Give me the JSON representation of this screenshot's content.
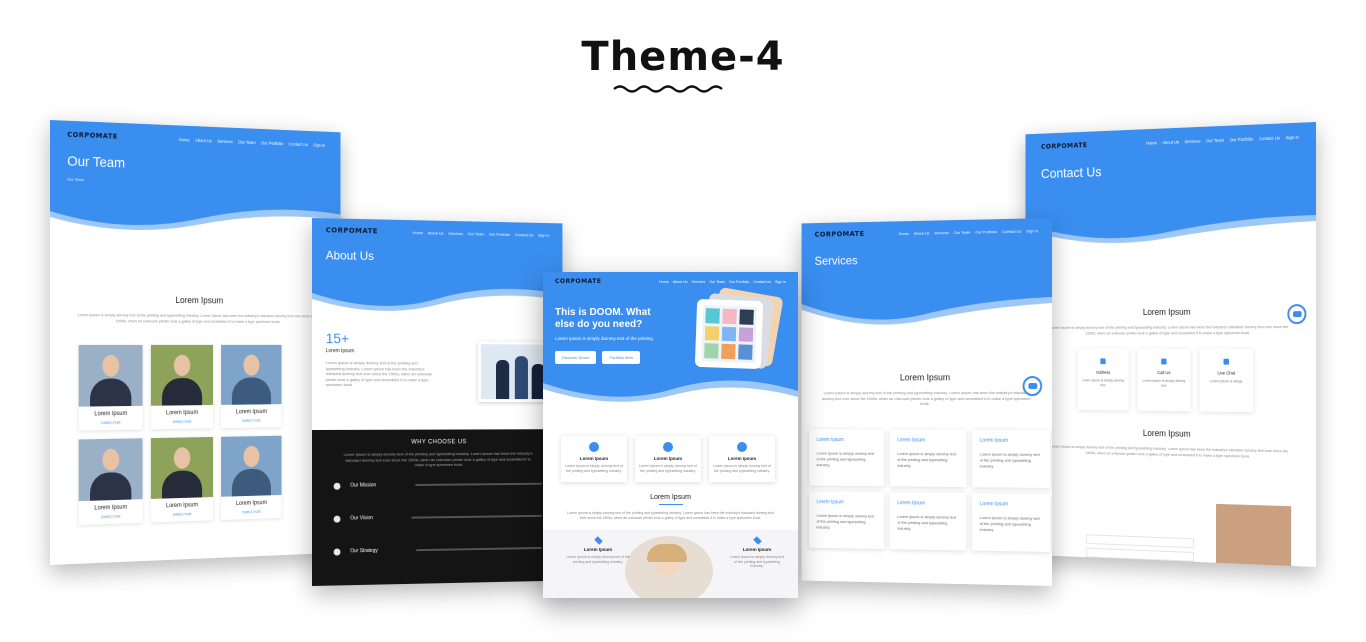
{
  "page": {
    "title": "Theme-4"
  },
  "brand": {
    "logo": "CORPOMATE",
    "accent": "#3a8ef0",
    "dark": "#141414"
  },
  "nav": [
    "Home",
    "About Us",
    "Services",
    "Our Team",
    "Our Portfolio",
    "Contact Us",
    "Sign in"
  ],
  "team": {
    "title": "Our Team",
    "breadcrumb": "Our Team",
    "section_title": "Lorem Ipsum",
    "members": [
      {
        "name": "Lorem Ipsum",
        "role": "DIRECTOR"
      },
      {
        "name": "Lorem Ipsum",
        "role": "DIRECTOR"
      },
      {
        "name": "Lorem Ipsum",
        "role": "DIRECTOR"
      },
      {
        "name": "Lorem Ipsum",
        "role": "DIRECTOR"
      },
      {
        "name": "Lorem Ipsum",
        "role": "DIRECTOR"
      },
      {
        "name": "Lorem Ipsum",
        "role": "DIRECTOR"
      }
    ]
  },
  "about": {
    "title": "About Us",
    "count": "15+",
    "count_label": "Lorem Ipsum",
    "why_title": "WHY CHOOSE US",
    "why_items": [
      "Our Mission",
      "Our Vision",
      "Our Strategy"
    ]
  },
  "home": {
    "headline": "This is DOOM. What else do you need?",
    "subtext": "Lorem Ipsum is simply dummy text of the printing.",
    "btn_primary": "Discover Doom",
    "btn_secondary": "Portfolio Item",
    "features": [
      {
        "title": "Lorem Ipsum",
        "desc": "Lorem Ipsum is simply dummy text of the printing and typesetting industry."
      },
      {
        "title": "Lorem Ipsum",
        "desc": "Lorem Ipsum is simply dummy text of the printing and typesetting industry."
      },
      {
        "title": "Lorem Ipsum",
        "desc": "Lorem Ipsum is simply dummy text of the printing and typesetting industry."
      }
    ],
    "section_title": "Lorem Ipsum",
    "bottom_left_title": "Lorem Ipsum",
    "bottom_left_desc": "Lorem Ipsum is simply dummy text of the printing and typesetting industry.",
    "bottom_right_title": "Lorem Ipsum",
    "bottom_right_desc": "Lorem Ipsum is simply dummy text of the printing and typesetting industry."
  },
  "services": {
    "title": "Services",
    "section_title": "Lorem Ipsum",
    "items": [
      {
        "title": "Lorem Ipsum",
        "desc": "Lorem Ipsum is simply dummy text of the printing and typesetting industry."
      },
      {
        "title": "Lorem Ipsum",
        "desc": "Lorem Ipsum is simply dummy text of the printing and typesetting industry."
      },
      {
        "title": "Lorem Ipsum",
        "desc": "Lorem Ipsum is simply dummy text of the printing and typesetting industry."
      },
      {
        "title": "Lorem Ipsum",
        "desc": "Lorem Ipsum is simply dummy text of the printing and typesetting industry."
      },
      {
        "title": "Lorem Ipsum",
        "desc": "Lorem Ipsum is simply dummy text of the printing and typesetting industry."
      },
      {
        "title": "Lorem Ipsum",
        "desc": "Lorem Ipsum is simply dummy text of the printing and typesetting industry."
      }
    ]
  },
  "contact": {
    "title": "Contact Us",
    "section_title": "Lorem Ipsum",
    "section_title_2": "Lorem Ipsum",
    "info": [
      {
        "title": "Address",
        "desc": "Lorem Ipsum is simply dummy text"
      },
      {
        "title": "Call Us",
        "desc": "Lorem Ipsum is simply dummy text"
      },
      {
        "title": "Live Chat",
        "desc": "Lorem Ipsum is simply"
      }
    ]
  },
  "lorem_para": "Lorem Ipsum is simply dummy text of the printing and typesetting industry. Lorem Ipsum has been the industry's standard dummy text ever since the 1500s, when an unknown printer took a galley of type and scrambled it to make a type specimen book."
}
